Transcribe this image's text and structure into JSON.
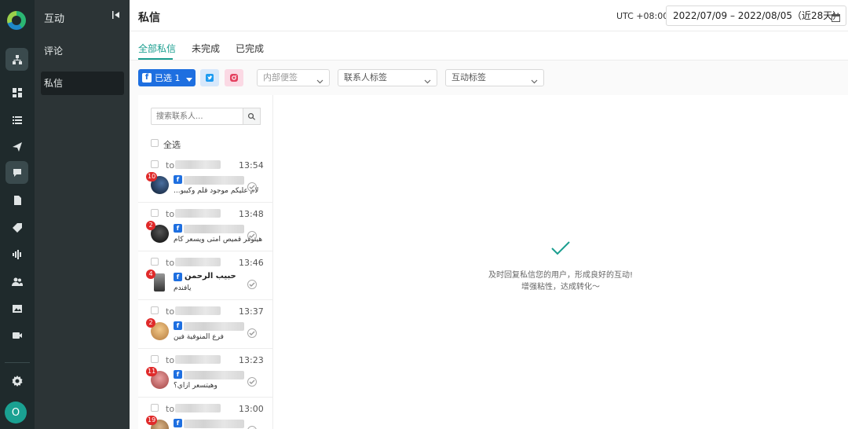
{
  "rail": {
    "icons": [
      "logo-icon",
      "hierarchy-icon",
      "dashboard-icon",
      "list-icon",
      "send-icon",
      "chat-icon",
      "document-icon",
      "tag-icon",
      "audio-icon",
      "users-icon",
      "image-icon",
      "video-icon",
      "gear-icon"
    ],
    "avatar_initial": "O"
  },
  "sidebar": {
    "title": "互动",
    "items": [
      {
        "label": "评论",
        "active": false
      },
      {
        "label": "私信",
        "active": true
      }
    ]
  },
  "header": {
    "title": "私信",
    "timezone": "UTC +08:00",
    "date_range": "2022/07/09 – 2022/08/05（近28天）"
  },
  "tabs": [
    {
      "label": "全部私信",
      "active": true
    },
    {
      "label": "未完成",
      "active": false
    },
    {
      "label": "已完成",
      "active": false
    }
  ],
  "filters": {
    "facebook_selected": "已选 1",
    "internal_note_placeholder": "内部便签",
    "contact_tag": "联系人标签",
    "interaction_tag": "互动标签"
  },
  "list": {
    "search_placeholder": "搜索联系人...",
    "select_all": "全选",
    "rows": [
      {
        "to": "to",
        "time": "13:54",
        "badge": "10",
        "name": "",
        "message": "...لام عليكم موجود قلم وكيبو"
      },
      {
        "to": "to",
        "time": "13:48",
        "badge": "2",
        "name": "",
        "message": "هيتوفر قميص امتى ويسعر كام"
      },
      {
        "to": "to",
        "time": "13:46",
        "badge": "4",
        "name": "حبيب الرحمن",
        "message": "يافندم"
      },
      {
        "to": "to",
        "time": "13:37",
        "badge": "2",
        "name": "",
        "message": "فرع المنوفية فين"
      },
      {
        "to": "to",
        "time": "13:23",
        "badge": "11",
        "name": "",
        "message": "وهيتسعر ازاي؟"
      },
      {
        "to": "to",
        "time": "13:00",
        "badge": "19",
        "name": "",
        "message": ""
      }
    ]
  },
  "empty_state": {
    "line1": "及时回复私信您的用户，形成良好的互动!",
    "line2": "增强粘性，达成转化～"
  },
  "colors": {
    "accent": "#1a9e8f",
    "facebook": "#1e6fe0",
    "badge": "#e02a2a",
    "rail_bg": "#1f2a2c",
    "sidebar_bg": "#2c3436"
  }
}
